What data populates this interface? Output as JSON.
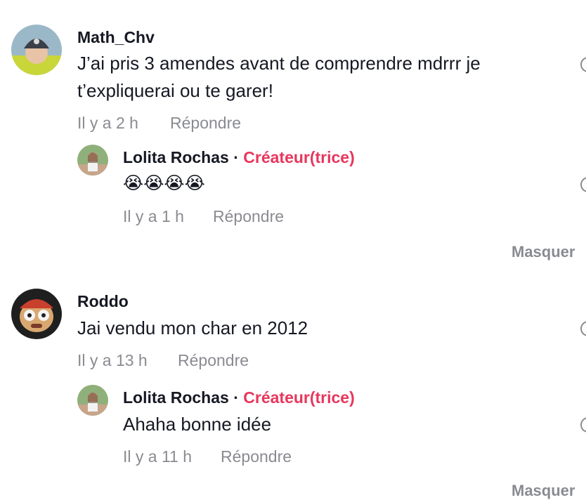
{
  "comments": [
    {
      "author": "Math_Chv",
      "text_line1": "J’ai pris 3 amendes avant de comprendre mdrrr je",
      "text_line2": "t’expliquerai ou te garer!",
      "time": "Il y a 2 h",
      "reply_label": "Répondre",
      "reply": {
        "author": "Lolita Rochas",
        "separator": "·",
        "badge": "Créateur(trice)",
        "text": "😭😭😭😭",
        "time": "Il y a 1 h",
        "reply_label": "Répondre"
      },
      "hide_label": "Masquer"
    },
    {
      "author": "Roddo",
      "text_line1": "Jai vendu mon char en 2012",
      "time": "Il y a 13 h",
      "reply_label": "Répondre",
      "reply": {
        "author": "Lolita Rochas",
        "separator": "·",
        "badge": "Créateur(trice)",
        "text": "Ahaha bonne idée",
        "time": "Il y a 11 h",
        "reply_label": "Répondre"
      },
      "hide_label": "Masquer"
    }
  ],
  "colors": {
    "creator_badge": "#e8365d",
    "muted": "#8a8b91",
    "text": "#161823"
  }
}
